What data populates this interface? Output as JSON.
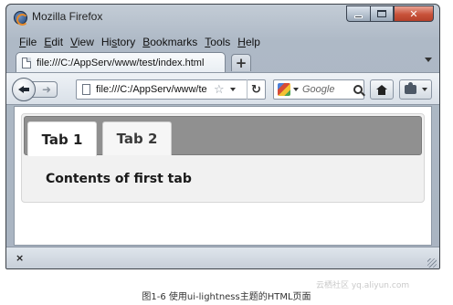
{
  "window": {
    "title": "Mozilla Firefox"
  },
  "menubar": {
    "items": [
      {
        "accel": "F",
        "rest": "ile"
      },
      {
        "accel": "E",
        "rest": "dit"
      },
      {
        "accel": "V",
        "rest": "iew"
      },
      {
        "accel": "",
        "rest": "Hi",
        "accel2": "s",
        "rest2": "tory"
      },
      {
        "accel": "B",
        "rest": "ookmarks"
      },
      {
        "accel": "T",
        "rest": "ools"
      },
      {
        "accel": "H",
        "rest": "elp"
      }
    ]
  },
  "browser_tab": {
    "title": "file:///C:/AppServ/www/test/index.html"
  },
  "toolbar": {
    "url": "file:///C:/AppServ/www/te",
    "search_placeholder": "Google",
    "new_tab": "+"
  },
  "page": {
    "tabs": [
      {
        "label": "Tab 1",
        "active": true
      },
      {
        "label": "Tab 2",
        "active": false
      }
    ],
    "panel_text": "Contents of first tab"
  },
  "statusbar": {
    "close_label": "×"
  },
  "figure": {
    "caption": "图1-6   使用ui-lightness主题的HTML页面",
    "watermark": "云栖社区 yq.aliyun.com"
  },
  "colors": {
    "tab_nav_bg": "#909090",
    "close_button": "#c8523a"
  }
}
